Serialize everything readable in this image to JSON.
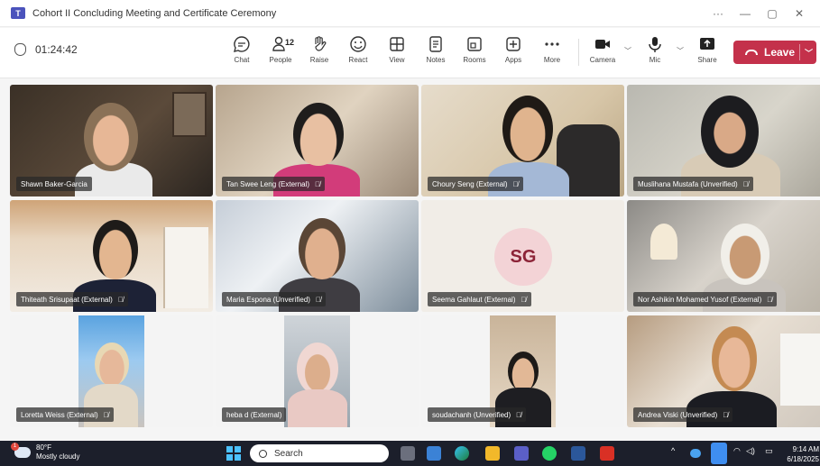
{
  "window": {
    "title": "Cohort II Concluding Meeting and Certificate Ceremony",
    "controls": [
      "···",
      "—",
      "▢",
      "✕"
    ]
  },
  "toolbar": {
    "timer": "01:24:42",
    "items": [
      {
        "label": "Chat",
        "icon": "chat-icon"
      },
      {
        "label": "People",
        "icon": "people-icon",
        "count": "12"
      },
      {
        "label": "Raise",
        "icon": "raise-hand-icon"
      },
      {
        "label": "React",
        "icon": "react-icon"
      },
      {
        "label": "View",
        "icon": "view-grid-icon"
      },
      {
        "label": "Notes",
        "icon": "notes-icon"
      },
      {
        "label": "Rooms",
        "icon": "rooms-icon"
      },
      {
        "label": "Apps",
        "icon": "apps-icon"
      },
      {
        "label": "More",
        "icon": "more-icon"
      },
      {
        "label": "Camera",
        "icon": "camera-icon"
      },
      {
        "label": "Mic",
        "icon": "mic-icon"
      },
      {
        "label": "Share",
        "icon": "share-icon"
      }
    ],
    "leave_label": "Leave"
  },
  "participants": [
    {
      "name": "Shawn Baker-Garcia",
      "muted": false
    },
    {
      "name": "Tan Swee Leng (External)",
      "muted": true
    },
    {
      "name": "Choury Seng (External)",
      "muted": true
    },
    {
      "name": "Muslihana Mustafa (Unverified)",
      "muted": true
    },
    {
      "name": "Thiteath Srisupaat (External)",
      "muted": true
    },
    {
      "name": "Maria Espona (Unverified)",
      "muted": true
    },
    {
      "name": "Seema Gahlaut (External)",
      "muted": true,
      "initials": "SG"
    },
    {
      "name": "Nor Ashikin Mohamed Yusof (External)",
      "muted": true
    },
    {
      "name": "Loretta Weiss (External)",
      "muted": true
    },
    {
      "name": "heba d (External)",
      "muted": false
    },
    {
      "name": "soudachanh (Unverified)",
      "muted": true
    },
    {
      "name": "Andrea Viski (Unverified)",
      "muted": true
    }
  ],
  "taskbar": {
    "weather_temp": "80°F",
    "weather_desc": "Mostly cloudy",
    "weather_badge": "1",
    "search_placeholder": "Search",
    "time": "9:14 AM",
    "date": "6/18/2025"
  },
  "colors": {
    "leave": "#c4314b",
    "accent": "#4b53bc",
    "taskbar": "#1c1f2b"
  }
}
